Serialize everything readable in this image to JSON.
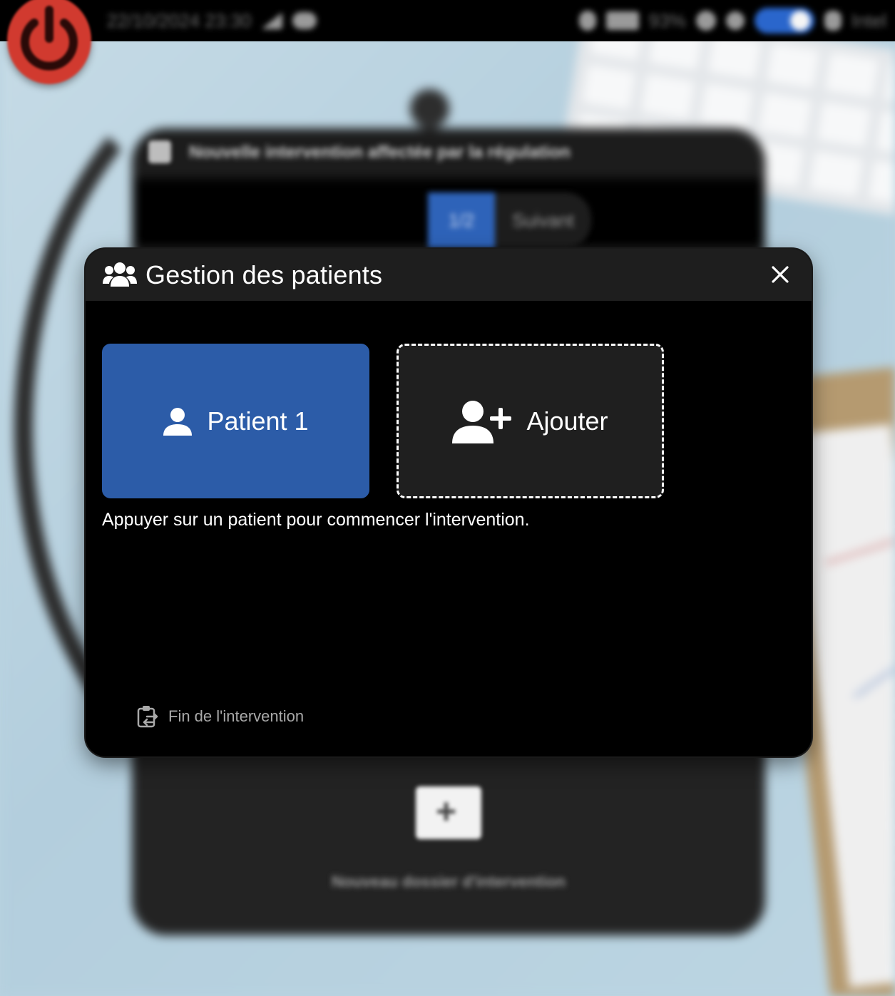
{
  "status_bar": {
    "datetime": "22/10/2024 23:30",
    "battery": "93%",
    "mode": "Intel"
  },
  "background": {
    "card_title": "Nouvelle intervention affectée par la régulation",
    "pager_page": "1/2",
    "pager_next": "Suivant",
    "folder_label": "Nouveau dossier d'intervention"
  },
  "modal": {
    "title": "Gestion des patients",
    "header_icon": "users-group-icon",
    "close_icon": "close-icon",
    "patients": [
      {
        "label": "Patient 1",
        "icon": "user-icon",
        "color": "#2c5ca8"
      }
    ],
    "add_tile": {
      "label": "Ajouter",
      "icon": "user-plus-icon"
    },
    "hint": "Appuyer sur un patient pour commencer l'intervention.",
    "end_button": {
      "label": "Fin de l'intervention",
      "icon": "clipboard-transfer-icon"
    }
  },
  "colors": {
    "accent": "#2c5ca8",
    "modal_bg": "#000000",
    "header_bg": "#1e1e1e",
    "power": "#d13a2f"
  }
}
